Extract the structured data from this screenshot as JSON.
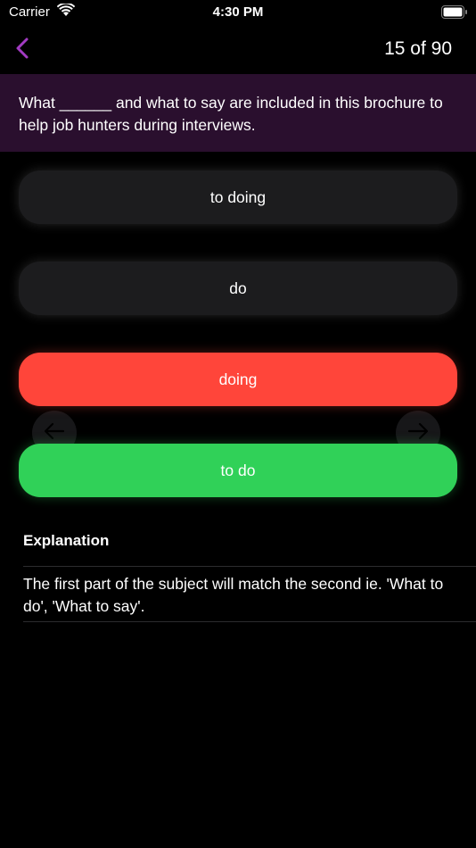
{
  "status_bar": {
    "carrier": "Carrier",
    "time": "4:30 PM"
  },
  "nav": {
    "back_icon": "chevron-left-icon",
    "counter": "15 of 90",
    "accent_color": "#a23bc2"
  },
  "question": {
    "text": "What ______ and what to say are included in this brochure to help job hunters during interviews."
  },
  "options": [
    {
      "label": "to doing",
      "state": "neutral"
    },
    {
      "label": "do",
      "state": "neutral"
    },
    {
      "label": "doing",
      "state": "wrong",
      "color": "#ff453a"
    },
    {
      "label": "to do",
      "state": "correct",
      "color": "#30d158"
    }
  ],
  "navigation_arrows": {
    "previous_icon": "arrow-left-icon",
    "next_icon": "arrow-right-icon"
  },
  "explanation": {
    "title": "Explanation",
    "text": "The first part of the subject will match the second ie. 'What to do', 'What to say'."
  }
}
